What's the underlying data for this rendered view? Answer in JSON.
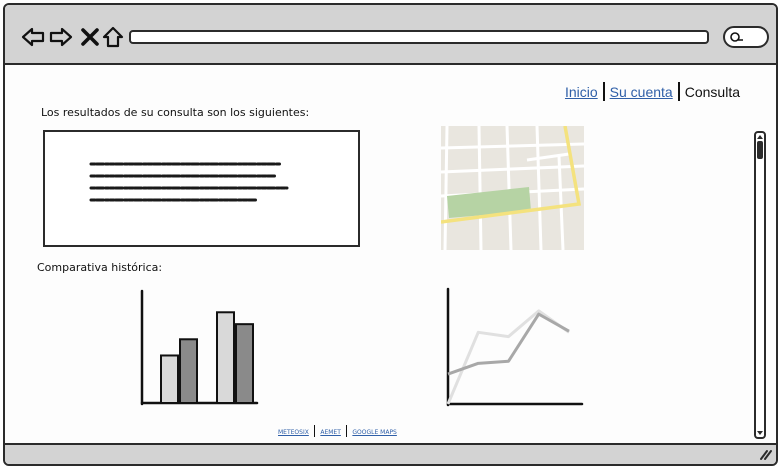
{
  "nav": {
    "links": [
      {
        "label": "Inicio"
      },
      {
        "label": "Su cuenta"
      }
    ],
    "current": "Consulta"
  },
  "results": {
    "label": "Los resultados de su consulta son los siguientes:"
  },
  "history": {
    "label": "Comparativa histórica:"
  },
  "charts": {
    "bar": {
      "type": "bar",
      "ylim": [
        0,
        100
      ],
      "groups": [
        {
          "values": [
            44,
            59
          ]
        },
        {
          "values": [
            84,
            73
          ]
        }
      ],
      "colors": [
        "#d9d9d9",
        "#8a8a8a"
      ]
    },
    "line": {
      "type": "line",
      "xlim": [
        0,
        4
      ],
      "ylim": [
        0,
        100
      ],
      "series": [
        {
          "values": [
            0,
            67,
            63,
            87,
            67
          ],
          "color": "#e0e0e0"
        },
        {
          "values": [
            28,
            38,
            40,
            84,
            68
          ],
          "color": "#a8a8a8"
        }
      ]
    }
  },
  "footer": {
    "links": [
      "METEOSIX",
      "AEMET",
      "GOOGLE MAPS"
    ]
  }
}
